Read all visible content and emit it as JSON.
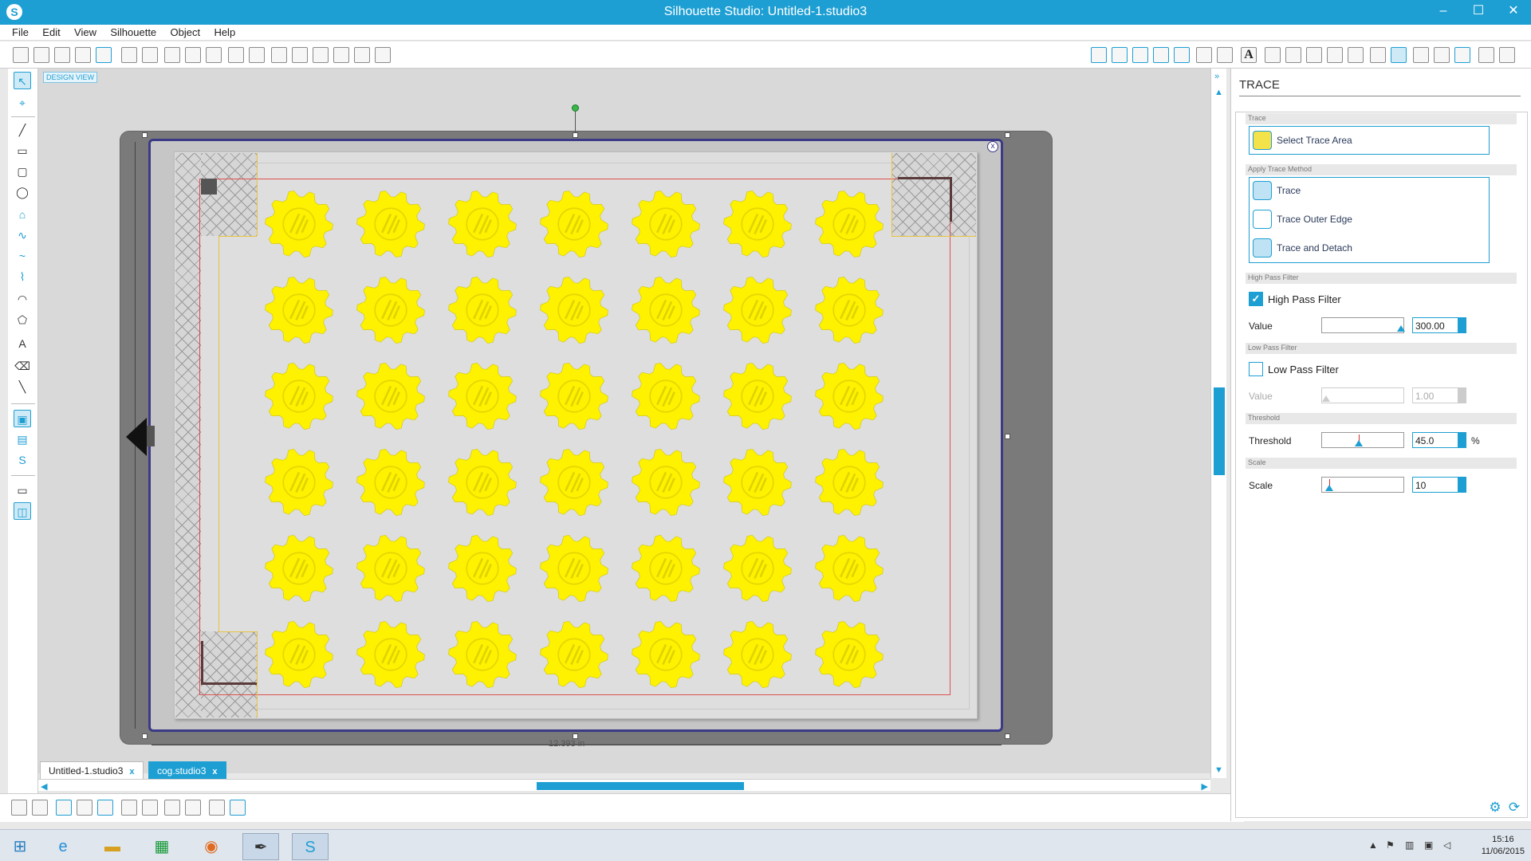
{
  "window": {
    "title": "Silhouette Studio: Untitled-1.studio3",
    "app_icon": "S",
    "minimize": "–",
    "maximize": "☐",
    "close": "✕"
  },
  "menu": [
    "File",
    "Edit",
    "View",
    "Silhouette",
    "Object",
    "Help"
  ],
  "canvas": {
    "view_label": "DESIGN VIEW",
    "width_dimension": "12.393 in",
    "close_glyph": "x",
    "gear_rows": 6,
    "gear_cols": 7,
    "gear_color": "#fff200"
  },
  "tabs": [
    {
      "label": "Untitled-1.studio3",
      "close": "x"
    },
    {
      "label": "cog.studio3",
      "close": "x"
    }
  ],
  "panel": {
    "title": "TRACE",
    "sections": {
      "trace": "Trace",
      "apply_method": "Apply Trace Method",
      "high_pass": "High Pass Filter",
      "low_pass": "Low Pass Filter",
      "threshold": "Threshold",
      "scale": "Scale"
    },
    "select_trace_area": "Select Trace Area",
    "methods": [
      "Trace",
      "Trace Outer Edge",
      "Trace and Detach"
    ],
    "high_pass_filter": {
      "label": "High Pass Filter",
      "checked": true,
      "value_label": "Value",
      "value": "300.00"
    },
    "low_pass_filter": {
      "label": "Low Pass Filter",
      "checked": false,
      "value_label": "Value",
      "value": "1.00"
    },
    "threshold": {
      "label": "Threshold",
      "value": "45.0",
      "unit": "%"
    },
    "scale": {
      "label": "Scale",
      "value": "10"
    },
    "check_glyph": "✓"
  },
  "taskbar": {
    "time": "15:16",
    "date": "11/06/2015"
  },
  "colors": {
    "accent": "#1e9fd3",
    "mat_border": "#3b3a86",
    "cut_line": "#e05050"
  }
}
